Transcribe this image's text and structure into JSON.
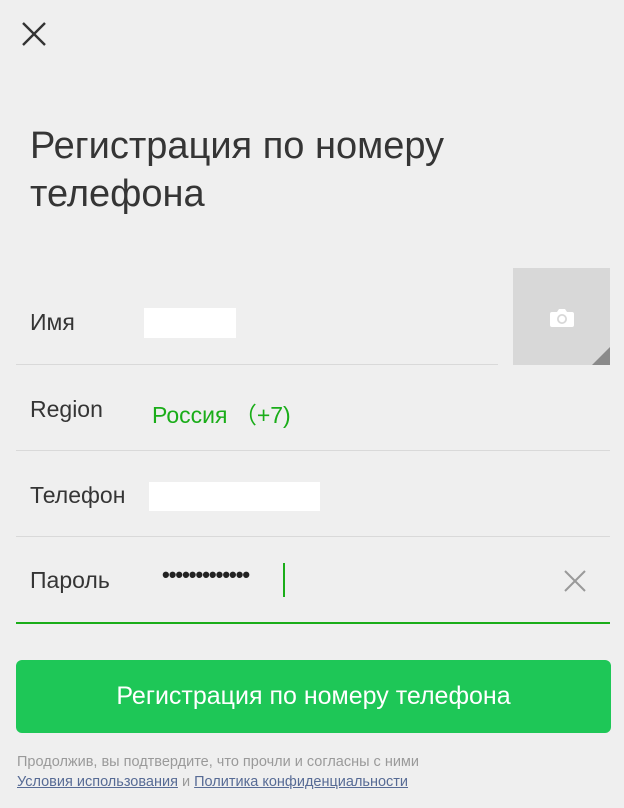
{
  "header": {
    "title": "Регистрация по номеру телефона"
  },
  "form": {
    "name": {
      "label": "Имя",
      "value": ""
    },
    "region": {
      "label": "Region",
      "value": "Россия （+7)"
    },
    "phone": {
      "label": "Телефон",
      "value": ""
    },
    "password": {
      "label": "Пароль",
      "masked_value": "•••••••••••••"
    }
  },
  "submit_label": "Регистрация по номеру телефона",
  "footer": {
    "disclaimer": "Продолжив, вы подтвердите, что прочли   и согласны с ними",
    "terms_link": "Условия использования",
    "and_text": " и ",
    "privacy_link": "Политика конфиденциальности"
  },
  "icons": {
    "close": "close-icon",
    "camera": "camera-icon",
    "clear": "clear-icon"
  },
  "colors": {
    "background": "#efefef",
    "accent_green": "#1aad19",
    "button_green": "#1ec757",
    "link_blue": "#576b95"
  }
}
